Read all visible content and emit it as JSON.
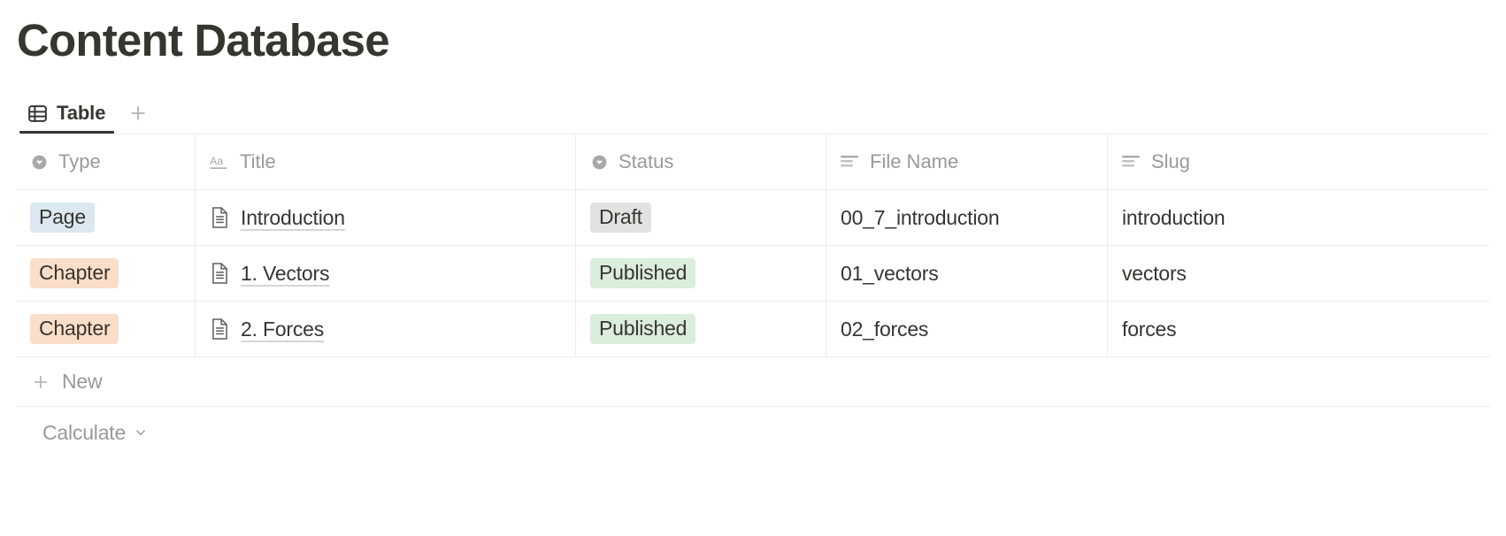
{
  "header": {
    "title": "Content Database"
  },
  "view_tabs": {
    "tabs": [
      {
        "label": "Table",
        "icon": "table-icon",
        "active": true
      }
    ],
    "add_view_icon": "plus-icon"
  },
  "table": {
    "columns": [
      {
        "key": "type",
        "label": "Type",
        "icon": "select-icon"
      },
      {
        "key": "title",
        "label": "Title",
        "icon": "title-aa-icon"
      },
      {
        "key": "status",
        "label": "Status",
        "icon": "select-icon"
      },
      {
        "key": "file",
        "label": "File Name",
        "icon": "text-lines-icon"
      },
      {
        "key": "slug",
        "label": "Slug",
        "icon": "text-lines-icon"
      }
    ],
    "rows": [
      {
        "type": "Page",
        "type_color": "#dbe8f1",
        "title": "Introduction",
        "title_icon": "page-document-icon",
        "status": "Draft",
        "status_color": "#e3e2e0",
        "file_name": "00_7_introduction",
        "slug": "introduction"
      },
      {
        "type": "Chapter",
        "type_color": "#fadec9",
        "title": "1. Vectors",
        "title_icon": "page-document-icon",
        "status": "Published",
        "status_color": "#dbeddb",
        "file_name": "01_vectors",
        "slug": "vectors"
      },
      {
        "type": "Chapter",
        "type_color": "#fadec9",
        "title": "2. Forces",
        "title_icon": "page-document-icon",
        "status": "Published",
        "status_color": "#dbeddb",
        "file_name": "02_forces",
        "slug": "forces"
      }
    ],
    "new_row_label": "New",
    "new_row_icon": "plus-icon",
    "calculate_label": "Calculate",
    "calculate_icon": "chevron-down-icon"
  },
  "colors": {
    "text_primary": "#37352f",
    "text_muted": "#9b9a97",
    "border": "#ececeb",
    "tab_underline": "#37352f"
  }
}
